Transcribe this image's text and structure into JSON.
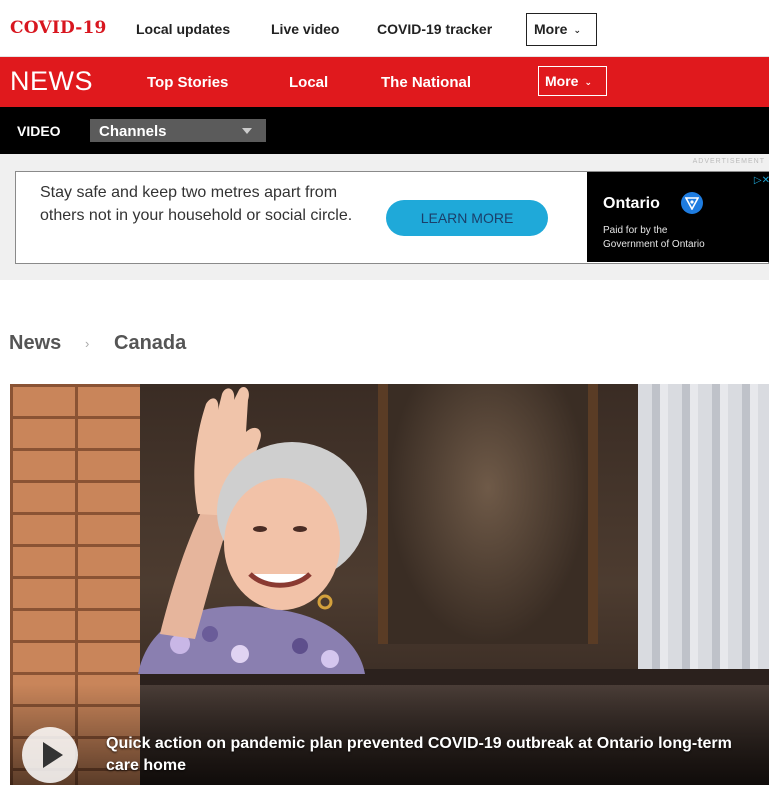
{
  "covid_bar": {
    "logo": "COVID-19",
    "links": [
      "Local updates",
      "Live video",
      "COVID-19 tracker"
    ],
    "more_label": "More"
  },
  "news_bar": {
    "logo": "NEWS",
    "links": [
      "Top Stories",
      "Local",
      "The National"
    ],
    "more_label": "More"
  },
  "video_bar": {
    "label": "VIDEO",
    "channels_label": "Channels"
  },
  "ad": {
    "label": "ADVERTISEMENT",
    "text": "Stay safe and keep two metres apart from others not in your household or social circle.",
    "button_label": "LEARN MORE",
    "sponsor_title": "Ontario",
    "sponsor_paid": "Paid for by the",
    "sponsor_gov": "Government of Ontario",
    "close_glyph": "▷✕"
  },
  "breadcrumb": {
    "section": "News",
    "separator": "›",
    "subsection": "Canada"
  },
  "hero": {
    "caption": "Quick action on pandemic plan prevented COVID-19 outbreak at Ontario long-term care home"
  },
  "colors": {
    "brand_red": "#e0191d",
    "ad_button": "#1fa9d9"
  }
}
